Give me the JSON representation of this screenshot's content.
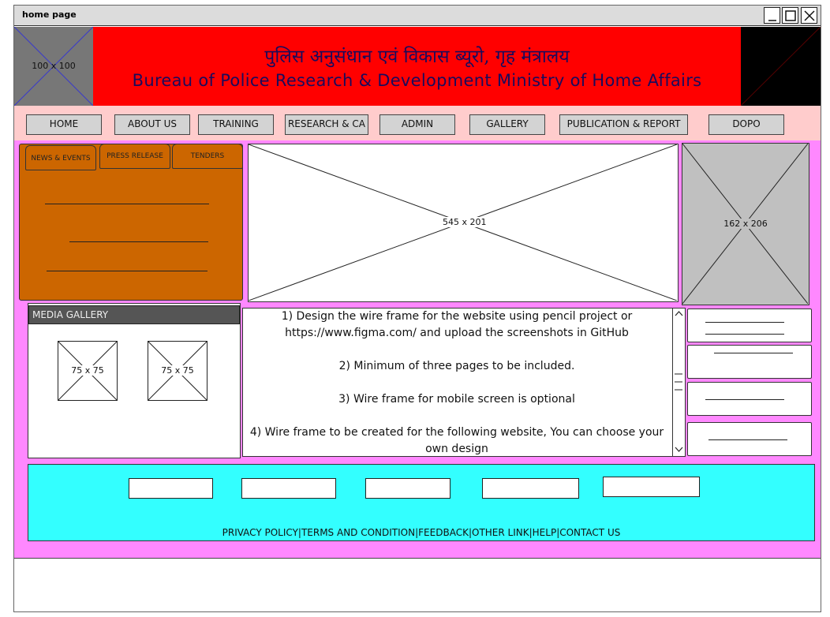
{
  "window": {
    "title": "home page"
  },
  "header": {
    "logo_left_label": "100 x 100",
    "title_hindi": "पुलिस अनुसंधान एवं विकास ब्यूरो, गृह मंत्रालय",
    "title_english": "Bureau of Police Research & Development Ministry of Home Affairs"
  },
  "nav": {
    "items": [
      {
        "label": "HOME"
      },
      {
        "label": "ABOUT US"
      },
      {
        "label": "TRAINING"
      },
      {
        "label": "RESEARCH & CA"
      },
      {
        "label": "ADMIN"
      },
      {
        "label": "GALLERY"
      },
      {
        "label": "PUBLICATION & REPORT"
      },
      {
        "label": "DOPO"
      }
    ]
  },
  "news": {
    "tabs": [
      {
        "label": "NEWS & EVENTS"
      },
      {
        "label": "PRESS RELEASE"
      },
      {
        "label": "TENDERS"
      }
    ]
  },
  "banner": {
    "label": "545 x 201"
  },
  "side_image": {
    "label": "162 x 206"
  },
  "media_gallery": {
    "title": "MEDIA GALLERY",
    "thumbs": [
      {
        "label": "75 x 75"
      },
      {
        "label": "75 x 75"
      }
    ]
  },
  "info": {
    "paragraphs": [
      "1) Design the wire frame for the website using pencil project or https://www.figma.com/ and upload the screenshots in GitHub",
      "2) Minimum of three pages to be included.",
      "3) Wire frame for mobile screen is optional",
      "4) Wire frame to be created for the following website, You can choose your own design"
    ]
  },
  "footer": {
    "links": [
      {
        "label": "PRIVACY POLICY"
      },
      {
        "label": "TERMS AND CONDITION"
      },
      {
        "label": "FEEDBACK"
      },
      {
        "label": "OTHER LINK"
      },
      {
        "label": "HELP"
      },
      {
        "label": "CONTACT US"
      }
    ],
    "separator": "|"
  },
  "colors": {
    "header_red": "#ff0000",
    "page_pink": "#ff88ff",
    "nav_pink": "#ffcccc",
    "news_orange": "#cc6600",
    "footer_cyan": "#33ffff",
    "title_ink": "#1a0b5c"
  }
}
